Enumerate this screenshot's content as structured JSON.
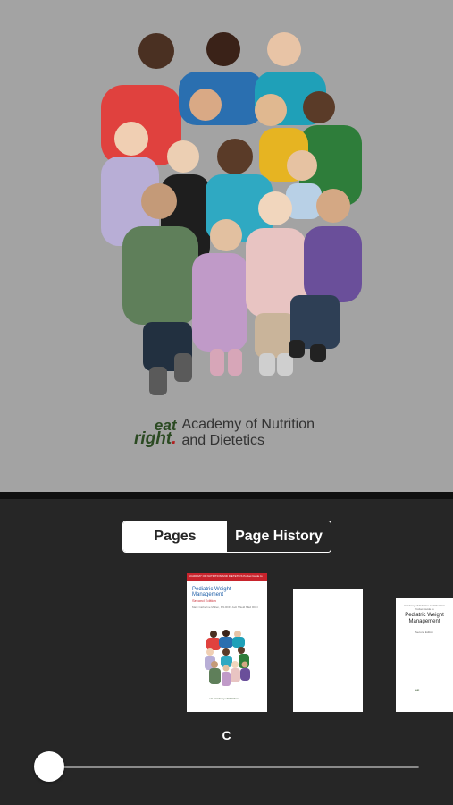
{
  "page_view": {
    "publisher": {
      "logo_eat": "eat",
      "logo_right": "right",
      "name_line1": "Academy of Nutrition",
      "name_line2": "and Dietetics"
    }
  },
  "tabs": [
    {
      "label": "Pages",
      "active": true
    },
    {
      "label": "Page History",
      "active": false
    }
  ],
  "thumbnails": {
    "cover": {
      "header": "ACADEMY OF NUTRITION AND DIETETICS Pocket Guide to",
      "title": "Pediatric Weight Management",
      "edition": "Second Edition",
      "authors": "Mary Catherine Mullen, MS RDN Jodi Shield MEd RDN"
    },
    "title_page": {
      "small": "Academy of Nutrition and Dietetics Pocket Guide to",
      "title": "Pediatric Weight Management",
      "edition": "Second Edition"
    }
  },
  "current_page_label": "C",
  "slider": {
    "position": 0.0
  },
  "colors": {
    "page_bg": "#a3a3a3",
    "chrome_bg": "#262626",
    "cover_band": "#c8232c",
    "cover_title": "#1f5fa8",
    "logo_green": "#2b4a22"
  }
}
